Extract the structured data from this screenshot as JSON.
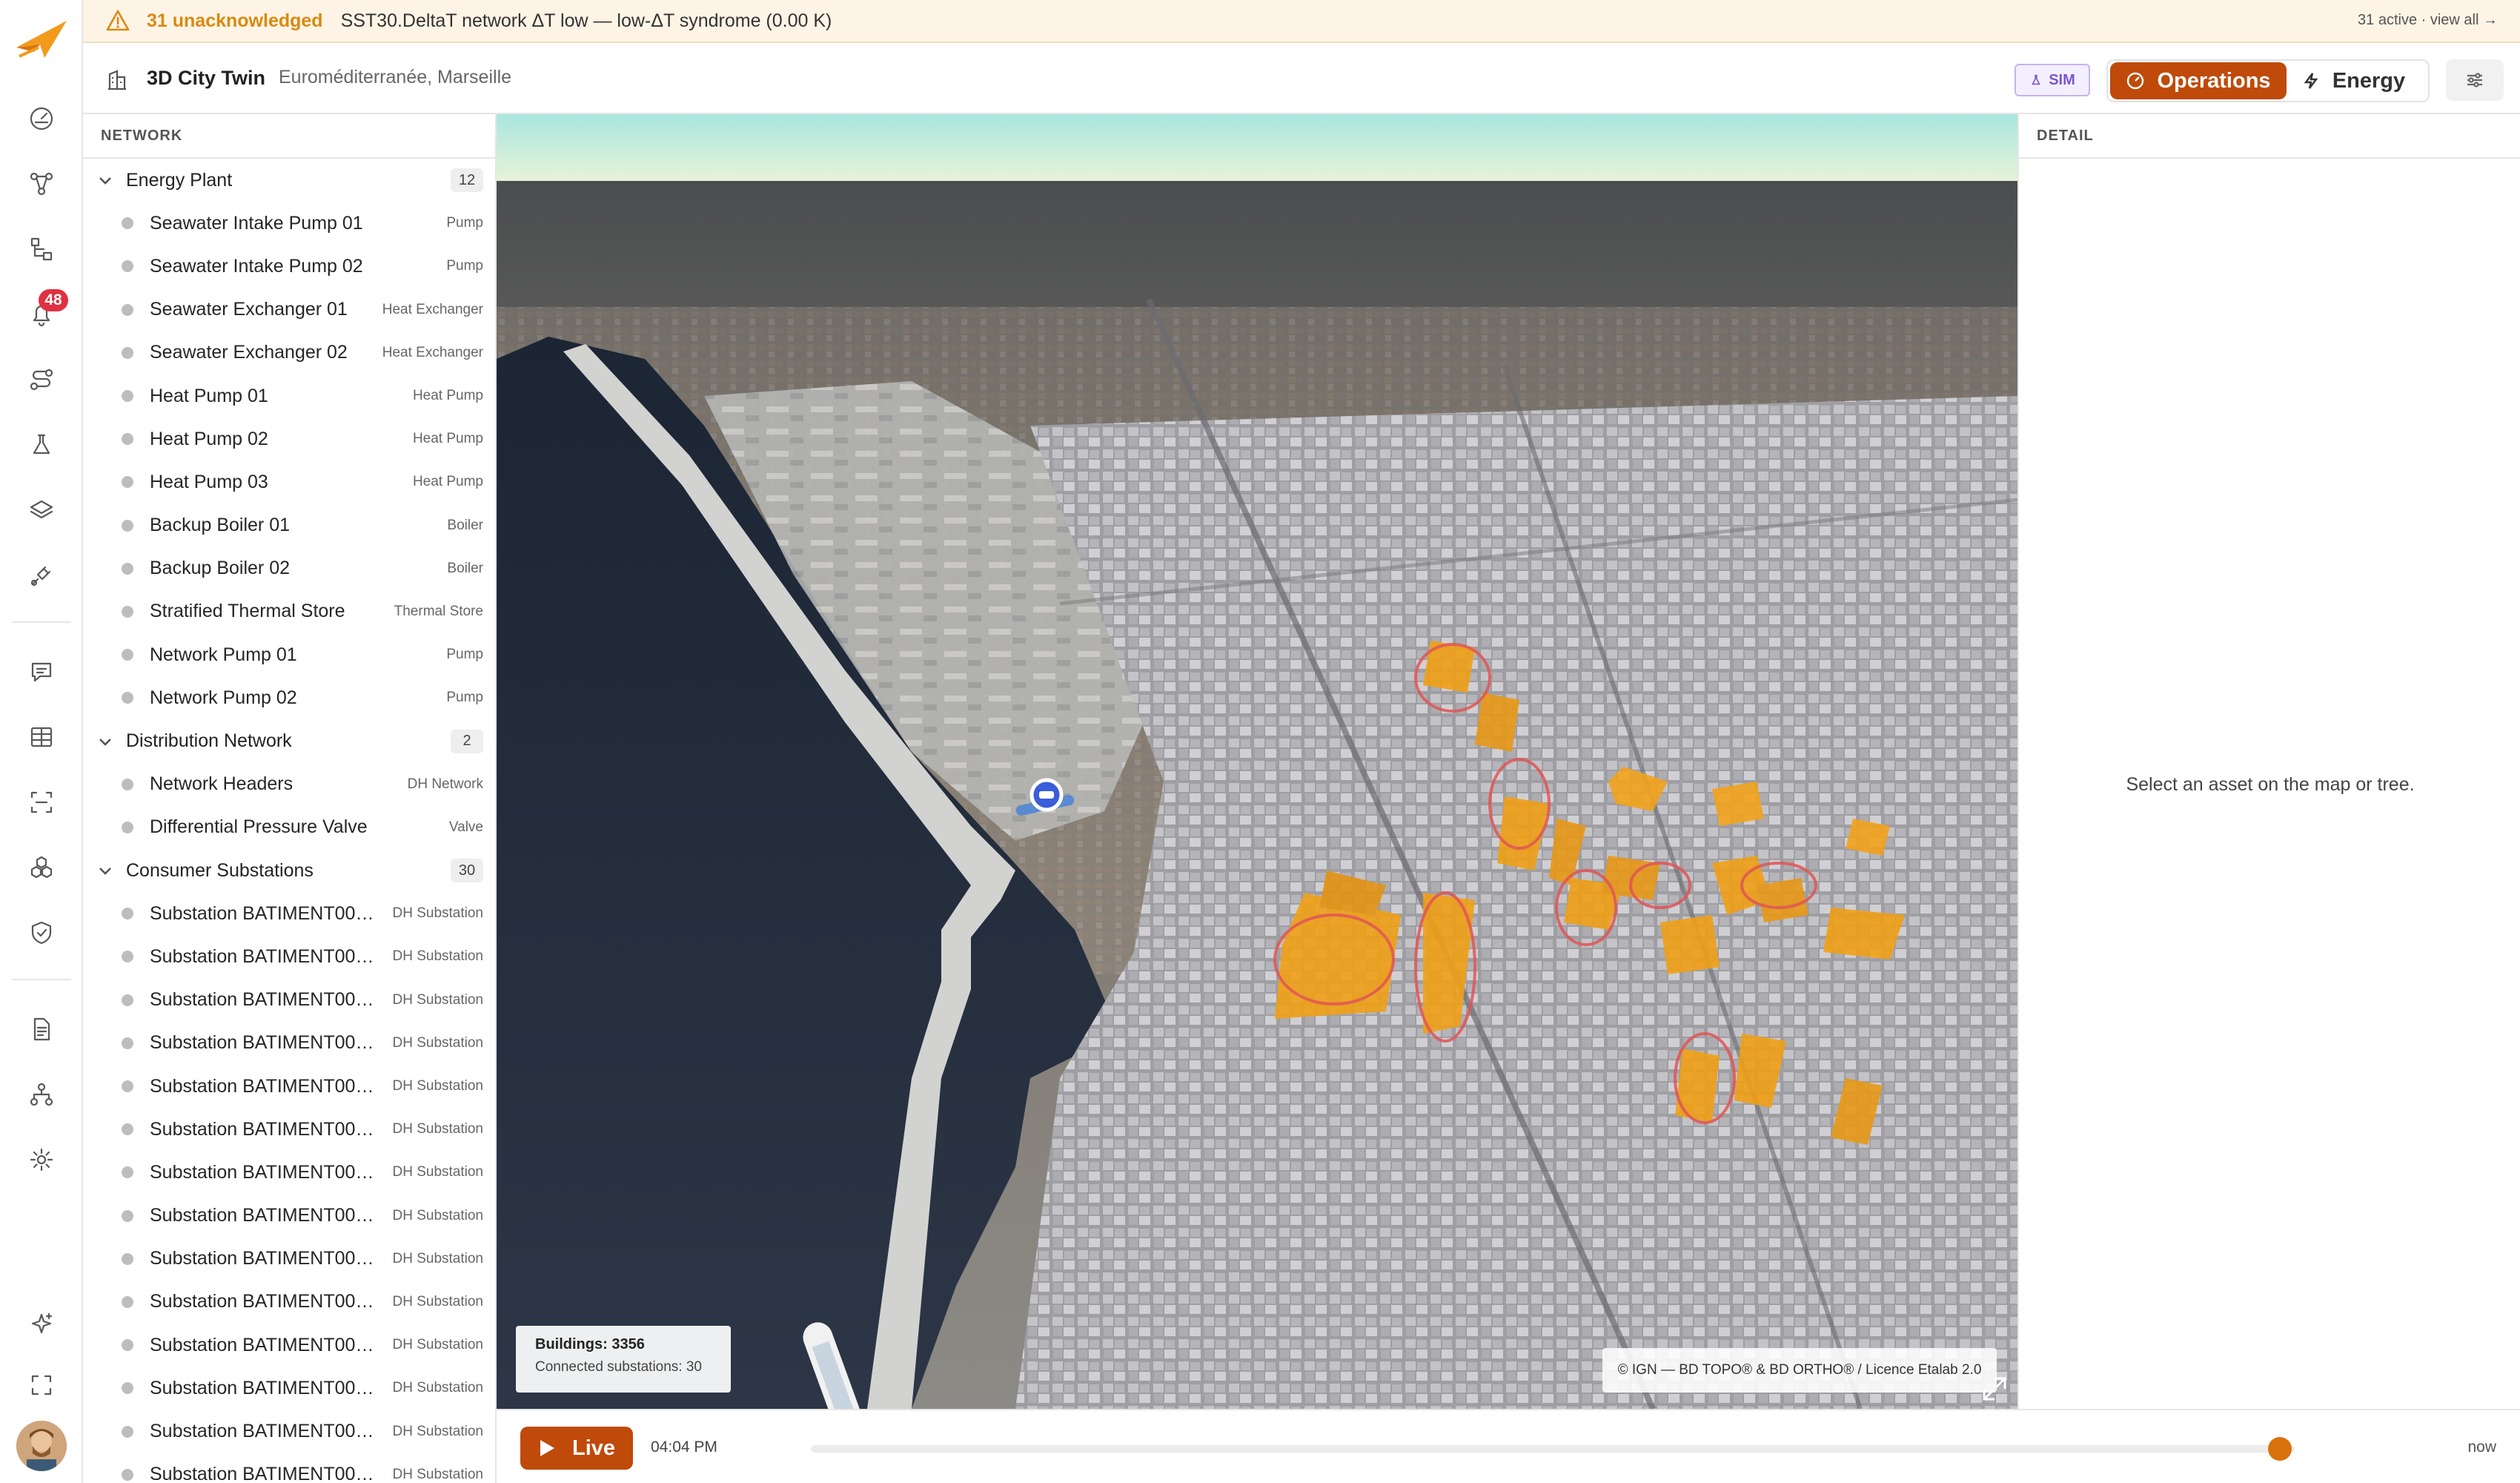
{
  "alert": {
    "count": "31 unacknowledged",
    "message": "SST30.DeltaT network ΔT low — low-ΔT syndrome (0.00 K)",
    "summary": "31 active · view all →"
  },
  "header": {
    "title": "3D City Twin",
    "subtitle": "Euroméditerranée, Marseille",
    "sim_label": "SIM",
    "modes": [
      {
        "label": "Operations",
        "active": true
      },
      {
        "label": "Energy",
        "active": false
      }
    ]
  },
  "rail": {
    "notification_count": "48",
    "icons": [
      "dashboard-icon",
      "network-graph-icon",
      "hierarchy-icon",
      "bell-icon",
      "route-icon",
      "flask-icon",
      "layers-icon",
      "plug-icon",
      "chat-icon",
      "table-icon",
      "scan-icon",
      "modules-icon",
      "shield-icon",
      "document-icon",
      "org-chart-icon",
      "settings-icon",
      "sparkles-icon",
      "fullscreen-icon"
    ]
  },
  "tree": {
    "heading": "NETWORK",
    "groups": [
      {
        "label": "Energy Plant",
        "count": "12",
        "items": [
          {
            "label": "Seawater Intake Pump 01",
            "type": "Pump"
          },
          {
            "label": "Seawater Intake Pump 02",
            "type": "Pump"
          },
          {
            "label": "Seawater Exchanger 01",
            "type": "Heat Exchanger"
          },
          {
            "label": "Seawater Exchanger 02",
            "type": "Heat Exchanger"
          },
          {
            "label": "Heat Pump 01",
            "type": "Heat Pump"
          },
          {
            "label": "Heat Pump 02",
            "type": "Heat Pump"
          },
          {
            "label": "Heat Pump 03",
            "type": "Heat Pump"
          },
          {
            "label": "Backup Boiler 01",
            "type": "Boiler"
          },
          {
            "label": "Backup Boiler 02",
            "type": "Boiler"
          },
          {
            "label": "Stratified Thermal Store",
            "type": "Thermal Store"
          },
          {
            "label": "Network Pump 01",
            "type": "Pump"
          },
          {
            "label": "Network Pump 02",
            "type": "Pump"
          }
        ]
      },
      {
        "label": "Distribution Network",
        "count": "2",
        "items": [
          {
            "label": "Network Headers",
            "type": "DH Network"
          },
          {
            "label": "Differential Pressure Valve",
            "type": "Valve"
          }
        ]
      },
      {
        "label": "Consumer Substations",
        "count": "30",
        "items": [
          {
            "label": "Substation BATIMENT0000…",
            "type": "DH Substation"
          },
          {
            "label": "Substation BATIMENT0000…",
            "type": "DH Substation"
          },
          {
            "label": "Substation BATIMENT0000…",
            "type": "DH Substation"
          },
          {
            "label": "Substation BATIMENT0000…",
            "type": "DH Substation"
          },
          {
            "label": "Substation BATIMENT0000…",
            "type": "DH Substation"
          },
          {
            "label": "Substation BATIMENT0000…",
            "type": "DH Substation"
          },
          {
            "label": "Substation BATIMENT0000…",
            "type": "DH Substation"
          },
          {
            "label": "Substation BATIMENT0000…",
            "type": "DH Substation"
          },
          {
            "label": "Substation BATIMENT0000…",
            "type": "DH Substation"
          },
          {
            "label": "Substation BATIMENT0000…",
            "type": "DH Substation"
          },
          {
            "label": "Substation BATIMENT0000…",
            "type": "DH Substation"
          },
          {
            "label": "Substation BATIMENT0000…",
            "type": "DH Substation"
          },
          {
            "label": "Substation BATIMENT0000…",
            "type": "DH Substation"
          },
          {
            "label": "Substation BATIMENT0000…",
            "type": "DH Substation"
          }
        ]
      }
    ]
  },
  "map": {
    "buildings_label": "Buildings: 3356",
    "connected_label": "Connected substations: 30",
    "attribution": "© IGN — BD TOPO® & BD ORTHO® / Licence Etalab 2.0"
  },
  "detail": {
    "heading": "DETAIL",
    "empty_text": "Select an asset on the map or tree."
  },
  "timeline": {
    "live_label": "Live",
    "time": "04:04 PM",
    "end_label": "now",
    "position_fraction": 0.99
  },
  "colors": {
    "accent": "#bf4a0a",
    "alert": "#d98a0e",
    "badge": "#e03142",
    "highlight": "#f2a21c"
  }
}
